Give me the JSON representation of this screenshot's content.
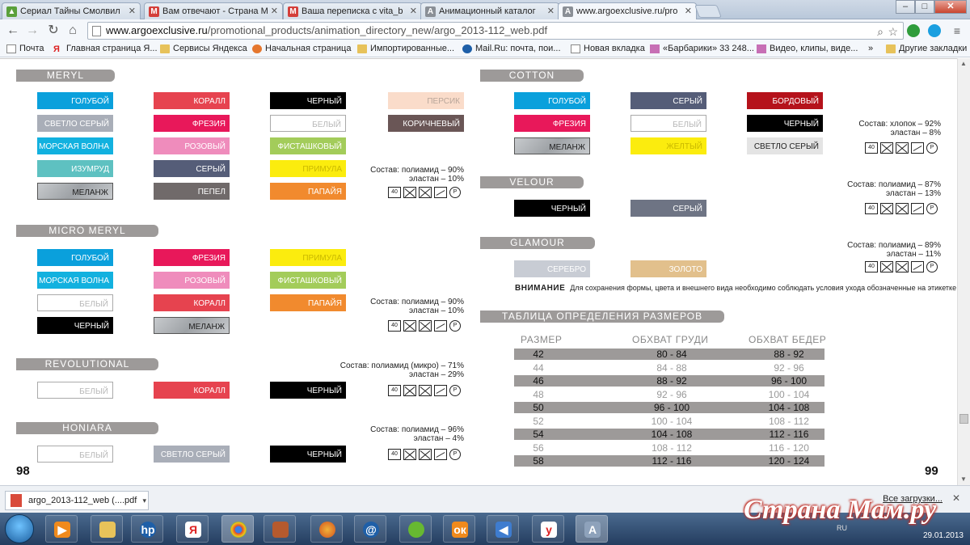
{
  "tabs": [
    {
      "title": "Сериал Тайны Смолвил",
      "color": "#5aa03b",
      "fav": "▲"
    },
    {
      "title": "Вам отвечают - Страна М",
      "color": "#d43f3a",
      "fav": "M"
    },
    {
      "title": "Ваша переписка с vita_b",
      "color": "#d43f3a",
      "fav": "M"
    },
    {
      "title": "Анимационный каталог",
      "color": "#8a8f96",
      "fav": "A"
    },
    {
      "title": "www.argoexclusive.ru/pro",
      "color": "#8a8f96",
      "fav": "A"
    }
  ],
  "window_buttons": {
    "min": "–",
    "max": "□",
    "close": "✕"
  },
  "address": {
    "domain": "www.argoexclusive.ru",
    "path": "/promotional_products/animation_directory_new/argo_2013-112_web.pdf"
  },
  "bookmarks": [
    "Почта",
    "Главная страница Я...",
    "Сервисы Яндекса",
    "Начальная страница",
    "Импортированные...",
    "Mail.Ru: почта, пои...",
    "Новая вкладка",
    "«Барбарики» 33 248...",
    "Видео, клипы, виде...",
    "Другие закладки"
  ],
  "left_page": {
    "page_number": "98",
    "sections": [
      {
        "name": "MERYL",
        "composition": [
          "Состав: полиамид – 90%",
          "эластан – 10%"
        ],
        "swatches": [
          {
            "label": "ГОЛУБОЙ",
            "color": "#0aa0dc",
            "style": "dark"
          },
          {
            "label": "КОРАЛЛ",
            "color": "#e6434f",
            "style": "dark"
          },
          {
            "label": "ЧЕРНЫЙ",
            "color": "#000000",
            "style": "dark"
          },
          {
            "label": "ПЕРСИК",
            "color": "#fadcca",
            "style": "peach"
          },
          {
            "label": "СВЕТЛО СЕРЫЙ",
            "color": "#a9aeb8",
            "style": "dark"
          },
          {
            "label": "ФРЕЗИЯ",
            "color": "#e8185a",
            "style": "dark"
          },
          {
            "label": "БЕЛЫЙ",
            "color": "#ffffff",
            "style": "light"
          },
          {
            "label": "КОРИЧНЕВЫЙ",
            "color": "#6a5656",
            "style": "dark"
          },
          {
            "label": "МОРСКАЯ ВОЛНА",
            "color": "#12b1df",
            "style": "dark"
          },
          {
            "label": "РОЗОВЫЙ",
            "color": "#ef8cbc",
            "style": "dark"
          },
          {
            "label": "ФИСТАШКОВЫЙ",
            "color": "#a3cc5a",
            "style": "dark"
          },
          {
            "label": "ИЗУМРУД",
            "color": "#5ec1c1",
            "style": "dark"
          },
          {
            "label": "СЕРЫЙ",
            "color": "#555d78",
            "style": "dark"
          },
          {
            "label": "ПРИМУЛА",
            "color": "#fbec0e",
            "style": "dark"
          },
          {
            "label": "МЕЛАНЖ",
            "color": "#b8bcc0",
            "style": "melange"
          },
          {
            "label": "ПЕПЕЛ",
            "color": "#706a6a",
            "style": "dark"
          },
          {
            "label": "ПАПАЙЯ",
            "color": "#f18a2e",
            "style": "dark"
          }
        ]
      },
      {
        "name": "MICRO MERYL",
        "composition": [
          "Состав: полиамид – 90%",
          "эластан – 10%"
        ],
        "swatches": [
          {
            "label": "ГОЛУБОЙ",
            "color": "#0aa0dc",
            "style": "dark"
          },
          {
            "label": "ФРЕЗИЯ",
            "color": "#e8185a",
            "style": "dark"
          },
          {
            "label": "ПРИМУЛА",
            "color": "#fbec0e",
            "style": "dark"
          },
          {
            "label": "МОРСКАЯ ВОЛНА",
            "color": "#12b1df",
            "style": "dark"
          },
          {
            "label": "РОЗОВЫЙ",
            "color": "#ef8cbc",
            "style": "dark"
          },
          {
            "label": "ФИСТАШКОВЫЙ",
            "color": "#a3cc5a",
            "style": "dark"
          },
          {
            "label": "БЕЛЫЙ",
            "color": "#ffffff",
            "style": "light"
          },
          {
            "label": "КОРАЛЛ",
            "color": "#e6434f",
            "style": "dark"
          },
          {
            "label": "ПАПАЙЯ",
            "color": "#f18a2e",
            "style": "dark"
          },
          {
            "label": "ЧЕРНЫЙ",
            "color": "#000000",
            "style": "dark"
          },
          {
            "label": "МЕЛАНЖ",
            "color": "#b8bcc0",
            "style": "melange"
          }
        ]
      },
      {
        "name": "REVOLUTIONAL",
        "composition": [
          "Состав: полиамид (микро) – 71%",
          "эластан – 29%"
        ],
        "swatches": [
          {
            "label": "БЕЛЫЙ",
            "color": "#ffffff",
            "style": "light"
          },
          {
            "label": "КОРАЛЛ",
            "color": "#e6434f",
            "style": "dark"
          },
          {
            "label": "ЧЕРНЫЙ",
            "color": "#000000",
            "style": "dark"
          }
        ]
      },
      {
        "name": "HONIARA",
        "composition": [
          "Состав: полиамид – 96%",
          "эластан – 4%"
        ],
        "swatches": [
          {
            "label": "БЕЛЫЙ",
            "color": "#ffffff",
            "style": "light"
          },
          {
            "label": "СВЕТЛО СЕРЫЙ",
            "color": "#a9aeb8",
            "style": "dark"
          },
          {
            "label": "ЧЕРНЫЙ",
            "color": "#000000",
            "style": "dark"
          }
        ]
      }
    ]
  },
  "right_page": {
    "page_number": "99",
    "sections": [
      {
        "name": "COTTON",
        "composition": [
          "Состав: хлопок – 92%",
          "эластан – 8%"
        ],
        "swatches": [
          {
            "label": "ГОЛУБОЙ",
            "color": "#0aa0dc",
            "style": "dark"
          },
          {
            "label": "СЕРЫЙ",
            "color": "#555d78",
            "style": "dark"
          },
          {
            "label": "БОРДОВЫЙ",
            "color": "#b5121b",
            "style": "dark"
          },
          {
            "label": "ФРЕЗИЯ",
            "color": "#e8185a",
            "style": "dark"
          },
          {
            "label": "БЕЛЫЙ",
            "color": "#ffffff",
            "style": "light"
          },
          {
            "label": "ЧЕРНЫЙ",
            "color": "#000000",
            "style": "dark"
          },
          {
            "label": "МЕЛАНЖ",
            "color": "#b8bcc0",
            "style": "melange"
          },
          {
            "label": "ЖЕЛТЫЙ",
            "color": "#fbec0e",
            "style": "dark"
          },
          {
            "label": "СВЕТЛО СЕРЫЙ",
            "color": "#e4e4e4",
            "style": "dark"
          }
        ]
      },
      {
        "name": "VELOUR",
        "composition": [
          "Состав: полиамид – 87%",
          "эластан – 13%"
        ],
        "swatches": [
          {
            "label": "ЧЕРНЫЙ",
            "color": "#000000",
            "style": "dark"
          },
          {
            "label": "СЕРЫЙ",
            "color": "#6e7484",
            "style": "dark"
          }
        ]
      },
      {
        "name": "GLAMOUR",
        "composition": [
          "Состав: полиамид – 89%",
          "эластан – 11%"
        ],
        "swatches": [
          {
            "label": "СЕРЕБРО",
            "color": "#c8ccd4",
            "style": "dark"
          },
          {
            "label": "ЗОЛОТО",
            "color": "#e2c08c",
            "style": "dark"
          }
        ]
      }
    ],
    "note_title": "ВНИМАНИЕ",
    "note_text": "Для сохранения формы, цвета и внешнего вида необходимо соблюдать условия ухода обозначенные на этикетке изделия.",
    "size_table": {
      "title": "ТАБЛИЦА ОПРЕДЕЛЕНИЯ РАЗМЕРОВ",
      "headers": [
        "РАЗМЕР",
        "ОБХВАТ ГРУДИ",
        "ОБХВАТ БЕДЕР"
      ],
      "rows": [
        [
          "42",
          "80 - 84",
          "88 - 92"
        ],
        [
          "44",
          "84 - 88",
          "92 - 96"
        ],
        [
          "46",
          "88 - 92",
          "96 - 100"
        ],
        [
          "48",
          "92 - 96",
          "100 - 104"
        ],
        [
          "50",
          "96 - 100",
          "104 - 108"
        ],
        [
          "52",
          "100 - 104",
          "108 - 112"
        ],
        [
          "54",
          "104 - 108",
          "112 - 116"
        ],
        [
          "56",
          "108 - 112",
          "116 - 120"
        ],
        [
          "58",
          "112 - 116",
          "120 - 124"
        ]
      ]
    }
  },
  "download": {
    "file": "argo_2013-112_web (....pdf",
    "all": "Все загрузки..."
  },
  "taskbar": {
    "brand": "Страна Мам.ру",
    "date": "29.01.2013",
    "lang": "RU"
  }
}
